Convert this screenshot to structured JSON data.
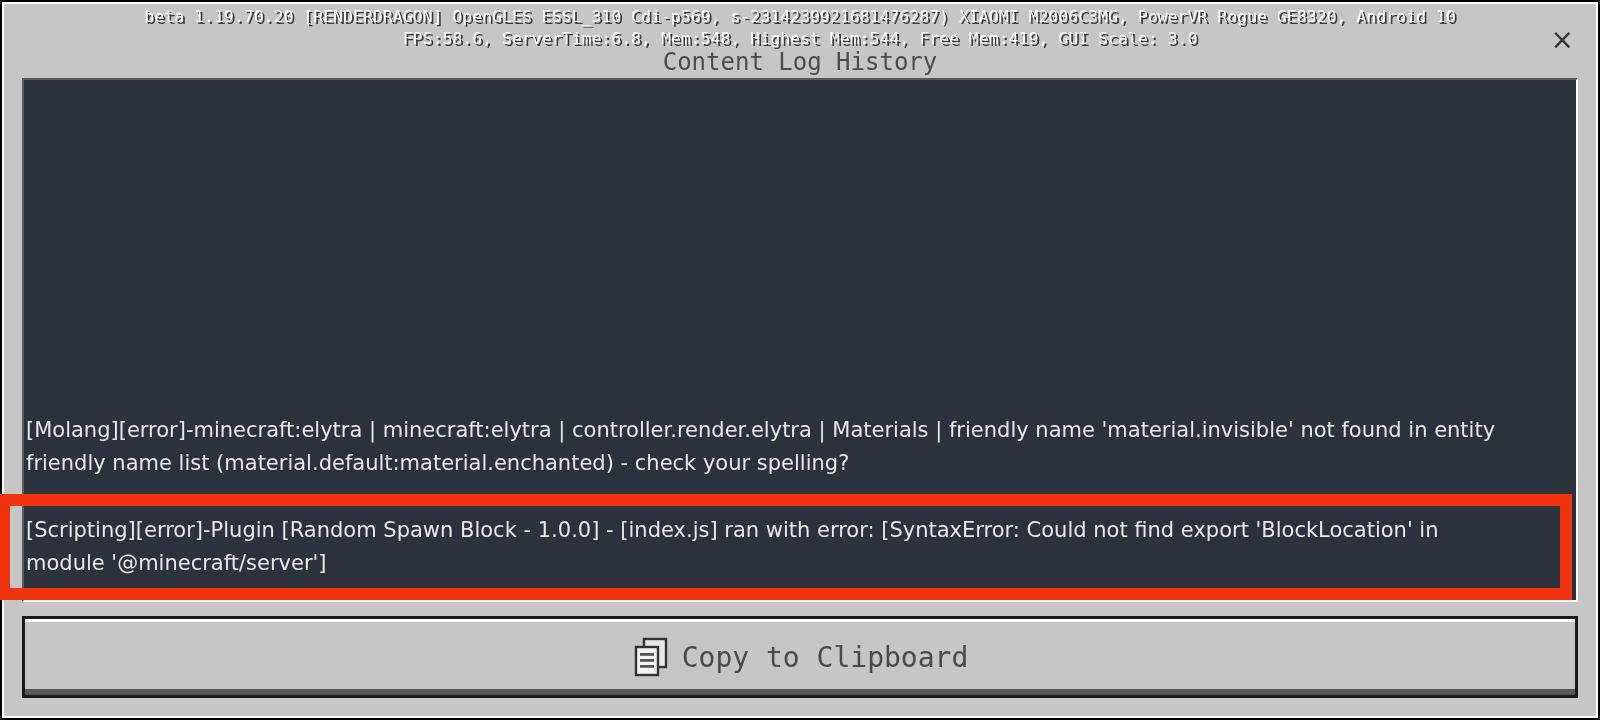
{
  "window": {
    "title": "Content Log History",
    "close": "×"
  },
  "debug_overlay": [
    "beta 1.19.70.20 [RENDERDRAGON] OpenGLES ESSL_310 Cdi-p569, s-2314239921681476287) XIAOMI M2006C3MG, PowerVR Rogue GE8320, Android 10",
    "FPS:58.6, ServerTime:6.8, Mem:548, Highest Mem:544, Free Mem:419, GUI Scale: 3.0"
  ],
  "log_entries": [
    {
      "text": "[Molang][error]-minecraft:elytra | minecraft:elytra | controller.render.elytra | Materials | friendly name 'material.invisible' not found in entity friendly name list (material.default:material.enchanted) - check your spelling?",
      "highlighted": false
    },
    {
      "text": "[Scripting][error]-Plugin [Random Spawn Block - 1.0.0] - [index.js] ran with error: [SyntaxError: Could not find export 'BlockLocation' in module '@minecraft/server']",
      "highlighted": true
    }
  ],
  "copy_button": {
    "label": "Copy to Clipboard"
  }
}
